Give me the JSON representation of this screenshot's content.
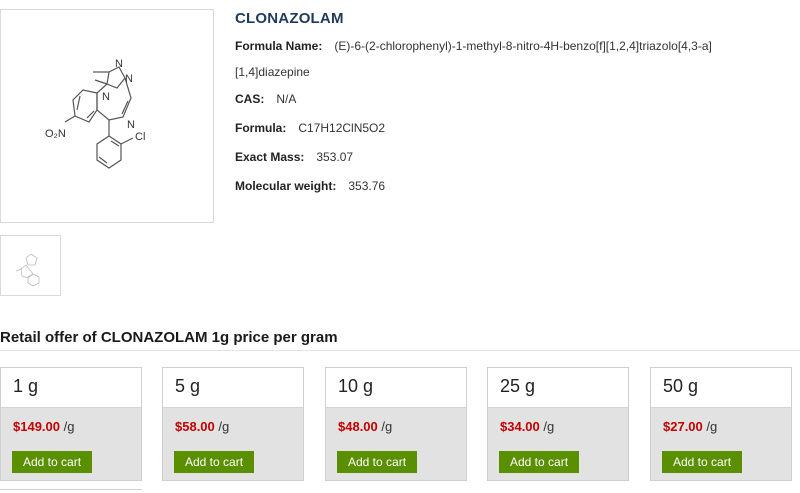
{
  "product": {
    "title": "CLONAZOLAM",
    "formula_name_label": "Formula Name:",
    "formula_name_line1": "(E)-6-(2-chlorophenyl)-1-methyl-8-nitro-4H-benzo[f][1,2,4]triazolo[4,3-a]",
    "formula_name_line2": "[1,4]diazepine",
    "cas_label": "CAS:",
    "cas_value": "N/A",
    "formula_label": "Formula:",
    "formula_value": "C17H12ClN5O2",
    "exact_mass_label": "Exact Mass:",
    "exact_mass_value": "353.07",
    "mol_weight_label": "Molecular weight:",
    "mol_weight_value": "353.76"
  },
  "structure_labels": {
    "n1": "N",
    "n2": "N",
    "n3": "N",
    "n4": "N",
    "no2": "O₂N",
    "cl": "Cl"
  },
  "offer": {
    "title": "Retail offer of CLONAZOLAM 1g price per gram",
    "cards": [
      {
        "qty": "1 g",
        "price": "$149.00",
        "unit": "/g",
        "button": "Add to cart"
      },
      {
        "qty": "5 g",
        "price": "$58.00",
        "unit": "/g",
        "button": "Add to cart"
      },
      {
        "qty": "10 g",
        "price": "$48.00",
        "unit": "/g",
        "button": "Add to cart"
      },
      {
        "qty": "25 g",
        "price": "$34.00",
        "unit": "/g",
        "button": "Add to cart"
      },
      {
        "qty": "50 g",
        "price": "$27.00",
        "unit": "/g",
        "button": "Add to cart"
      }
    ]
  },
  "colors": {
    "title": "#1f3a5a",
    "price": "#c40000",
    "button": "#5a8f00",
    "card_bg": "#e2e2e2"
  }
}
